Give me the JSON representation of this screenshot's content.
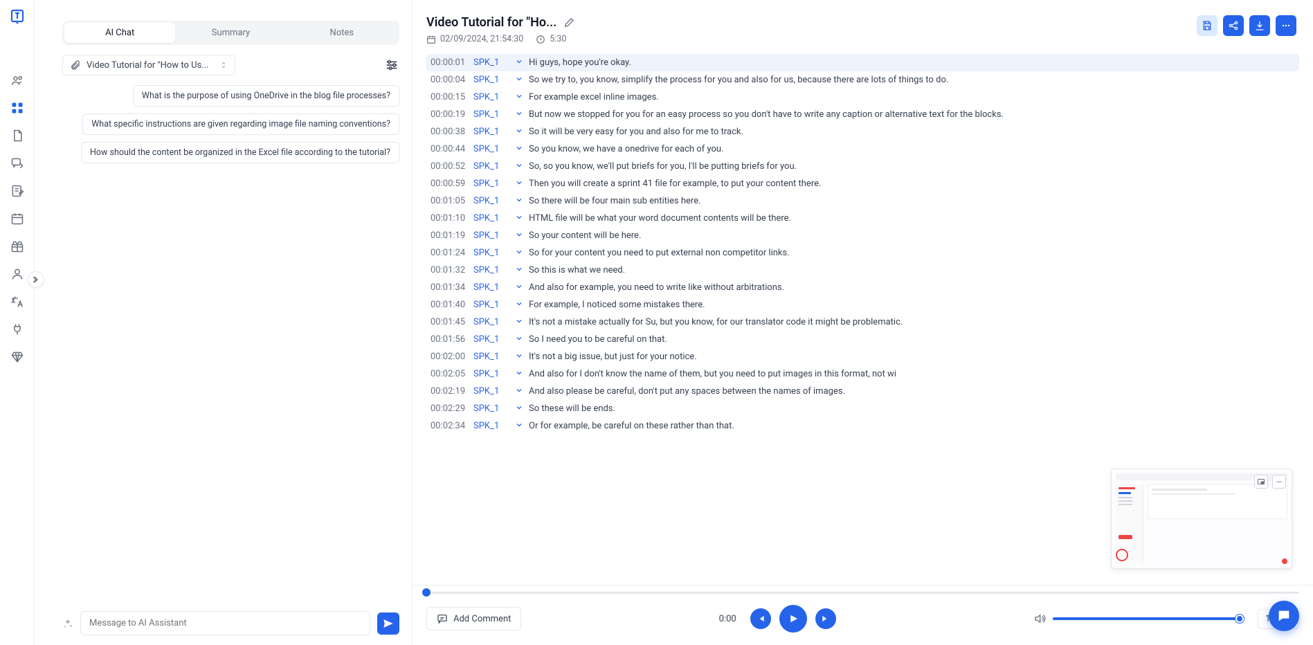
{
  "tabs": {
    "ai_chat": "AI Chat",
    "summary": "Summary",
    "notes": "Notes"
  },
  "file_selector": "Video Tutorial for \"How to Us...",
  "suggestions": [
    "What is the purpose of using OneDrive in the blog file processes?",
    "What specific instructions are given regarding image file naming conventions?",
    "How should the content be organized in the Excel file according to the tutorial?"
  ],
  "chat_placeholder": "Message to AI Assistant",
  "header": {
    "title": "Video Tutorial for \"Ho...",
    "date": "02/09/2024, 21:54:30",
    "duration": "5:30"
  },
  "transcript": [
    {
      "time": "00:00:01",
      "speaker": "SPK_1",
      "text": "Hi guys, hope you're okay.",
      "active": true
    },
    {
      "time": "00:00:04",
      "speaker": "SPK_1",
      "text": "So we try to, you know, simplify the process for you and also for us, because there are lots of things to do."
    },
    {
      "time": "00:00:15",
      "speaker": "SPK_1",
      "text": "For example excel inline images."
    },
    {
      "time": "00:00:19",
      "speaker": "SPK_1",
      "text": "But now we stopped for you for an easy process so you don't have to write any caption or alternative text for the blocks."
    },
    {
      "time": "00:00:38",
      "speaker": "SPK_1",
      "text": "So it will be very easy for you and also for me to track."
    },
    {
      "time": "00:00:44",
      "speaker": "SPK_1",
      "text": "So you know, we have a onedrive for each of you."
    },
    {
      "time": "00:00:52",
      "speaker": "SPK_1",
      "text": "So, so you know, we'll put briefs for you, I'll be putting briefs for you."
    },
    {
      "time": "00:00:59",
      "speaker": "SPK_1",
      "text": "Then you will create a sprint 41 file for example, to put your content there."
    },
    {
      "time": "00:01:05",
      "speaker": "SPK_1",
      "text": "So there will be four main sub entities here."
    },
    {
      "time": "00:01:10",
      "speaker": "SPK_1",
      "text": "HTML file will be what your word document contents will be there."
    },
    {
      "time": "00:01:19",
      "speaker": "SPK_1",
      "text": "So your content will be here."
    },
    {
      "time": "00:01:24",
      "speaker": "SPK_1",
      "text": "So for your content you need to put external non competitor links."
    },
    {
      "time": "00:01:32",
      "speaker": "SPK_1",
      "text": "So this is what we need."
    },
    {
      "time": "00:01:34",
      "speaker": "SPK_1",
      "text": "And also for example, you need to write like without arbitrations."
    },
    {
      "time": "00:01:40",
      "speaker": "SPK_1",
      "text": "For example, I noticed some mistakes there."
    },
    {
      "time": "00:01:45",
      "speaker": "SPK_1",
      "text": "It's not a mistake actually for Su, but you know, for our translator code it might be problematic."
    },
    {
      "time": "00:01:56",
      "speaker": "SPK_1",
      "text": "So I need you to be careful on that."
    },
    {
      "time": "00:02:00",
      "speaker": "SPK_1",
      "text": "It's not a big issue, but just for your notice."
    },
    {
      "time": "00:02:05",
      "speaker": "SPK_1",
      "text": "And also for I don't know the name of them, but you need to put images in this format, not wi"
    },
    {
      "time": "00:02:19",
      "speaker": "SPK_1",
      "text": "And also please be careful, don't put any spaces between the names of images."
    },
    {
      "time": "00:02:29",
      "speaker": "SPK_1",
      "text": "So these will be ends."
    },
    {
      "time": "00:02:34",
      "speaker": "SPK_1",
      "text": "Or for example, be careful on these rather than that."
    }
  ],
  "player": {
    "add_comment": "Add Comment",
    "current_time": "0:00",
    "speed": "1x"
  }
}
